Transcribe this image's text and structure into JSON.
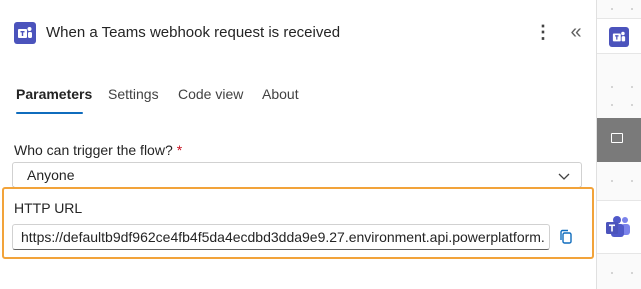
{
  "header": {
    "title": "When a Teams webhook request is received",
    "more_glyph": "⋮",
    "collapse_glyph": "«",
    "icon": "teams-icon"
  },
  "tabs": [
    {
      "label": "Parameters",
      "active": true
    },
    {
      "label": "Settings",
      "active": false
    },
    {
      "label": "Code view",
      "active": false
    },
    {
      "label": "About",
      "active": false
    }
  ],
  "trigger": {
    "label": "Who can trigger the flow?",
    "required_mark": "*",
    "value": "Anyone"
  },
  "http_url": {
    "label": "HTTP URL",
    "value": "https://defaultb9df962ce4fb4f5da4ecdbd3dda9e9.27.environment.api.powerplatform.c...",
    "copy_icon": "copy-icon"
  },
  "colors": {
    "accent": "#0f6cbd",
    "teams": "#4b53bc",
    "highlight": "#f2a33a",
    "required": "#c50f1f"
  }
}
